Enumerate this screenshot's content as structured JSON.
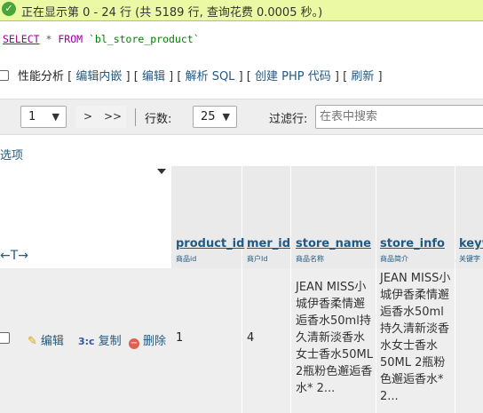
{
  "banner": {
    "check_icon": "check-circle-icon",
    "text": "正在显示第 0 - 24 行 (共 5189 行, 查询花费 0.0005 秒。)"
  },
  "sql": {
    "select": "SELECT",
    "star": "*",
    "from": "FROM",
    "table": "`bl_store_product`"
  },
  "toolbar": {
    "profiling": "性能分析",
    "open": "[",
    "close": "]",
    "links": [
      "编辑内嵌",
      "编辑",
      "解析 SQL",
      "创建 PHP 代码",
      "刷新"
    ]
  },
  "nav": {
    "page_value": "1",
    "next": ">",
    "last": ">>",
    "rows_label": "行数:",
    "rows_value": "25",
    "filter_label": "过滤行:",
    "filter_placeholder": "在表中搜索"
  },
  "options_link": "选项",
  "columns": [
    {
      "name": "product_id",
      "comment": "商品id"
    },
    {
      "name": "mer_id",
      "comment": "商户Id"
    },
    {
      "name": "store_name",
      "comment": "商品名称"
    },
    {
      "name": "store_info",
      "comment": "商品简介"
    },
    {
      "name": "keyw",
      "comment": "关键字"
    }
  ],
  "row": {
    "edit": "编辑",
    "copy": "复制",
    "delete": "删除",
    "product_id": "1",
    "mer_id": "4",
    "store_name": [
      "JEAN MISS小",
      "城伊香柔情邂",
      "逅香水50ml持",
      "久清新淡香水",
      "女士香水50ML",
      "2瓶粉色邂逅香",
      "水* 2..."
    ],
    "store_info": [
      "JEAN MISS小",
      "城伊香柔情邂",
      "逅香水50ml",
      "持久清新淡香",
      "水女士香水",
      "50ML 2瓶粉",
      "色邂逅香水*",
      "2..."
    ]
  }
}
